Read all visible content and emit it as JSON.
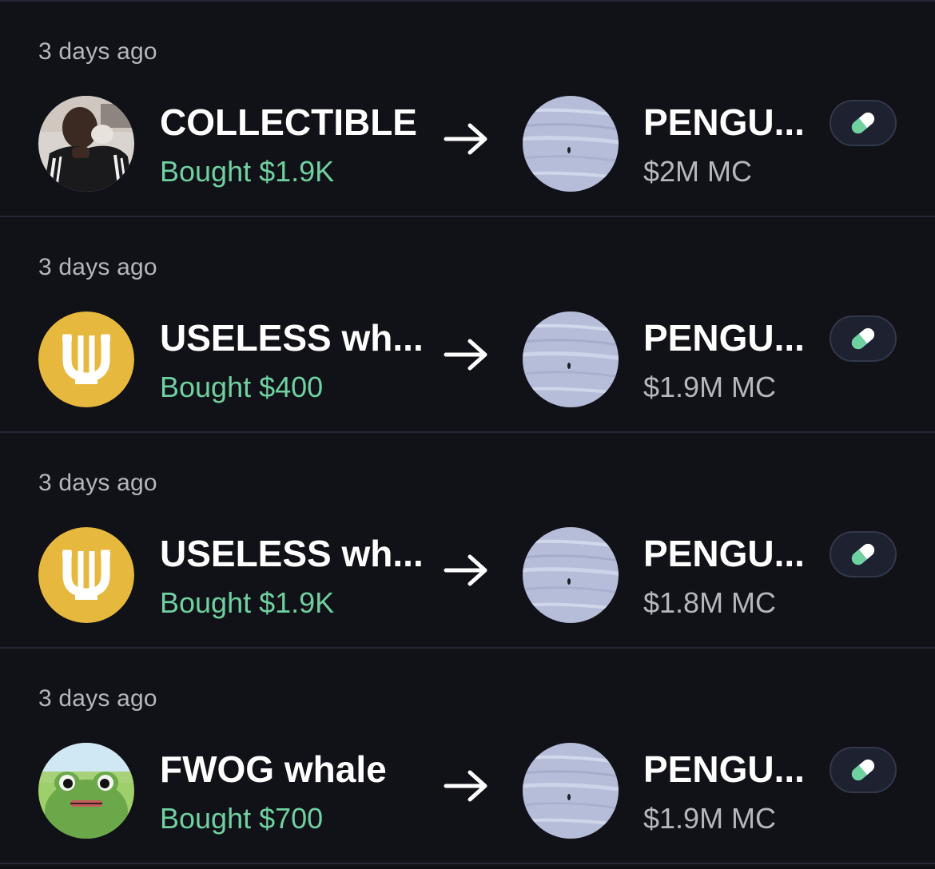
{
  "feed": {
    "trades": [
      {
        "time": "3 days ago",
        "trader": "COLLECTIBLE",
        "trader_avatar": "person-photo-avatar",
        "amount": "Bought $1.9K",
        "token": "PENGU...",
        "token_avatar": "snow-penguin-avatar",
        "market_cap": "$2M MC",
        "action_icon": "pill-icon"
      },
      {
        "time": "3 days ago",
        "trader": "USELESS wh...",
        "trader_avatar": "useless-coin-avatar",
        "amount": "Bought $400",
        "token": "PENGU...",
        "token_avatar": "snow-penguin-avatar",
        "market_cap": "$1.9M MC",
        "action_icon": "pill-icon"
      },
      {
        "time": "3 days ago",
        "trader": "USELESS wh...",
        "trader_avatar": "useless-coin-avatar",
        "amount": "Bought $1.9K",
        "token": "PENGU...",
        "token_avatar": "snow-penguin-avatar",
        "market_cap": "$1.8M MC",
        "action_icon": "pill-icon"
      },
      {
        "time": "3 days ago",
        "trader": "FWOG whale",
        "trader_avatar": "frog-avatar",
        "amount": "Bought $700",
        "token": "PENGU...",
        "token_avatar": "snow-penguin-avatar",
        "market_cap": "$1.9M MC",
        "action_icon": "pill-icon"
      }
    ]
  },
  "colors": {
    "background": "#111118",
    "divider": "#242836",
    "bought_green": "#6fd0a0",
    "muted_text": "#b4b7be",
    "useless_gold": "#e7b83e",
    "pill_green": "#6fd0a0"
  }
}
